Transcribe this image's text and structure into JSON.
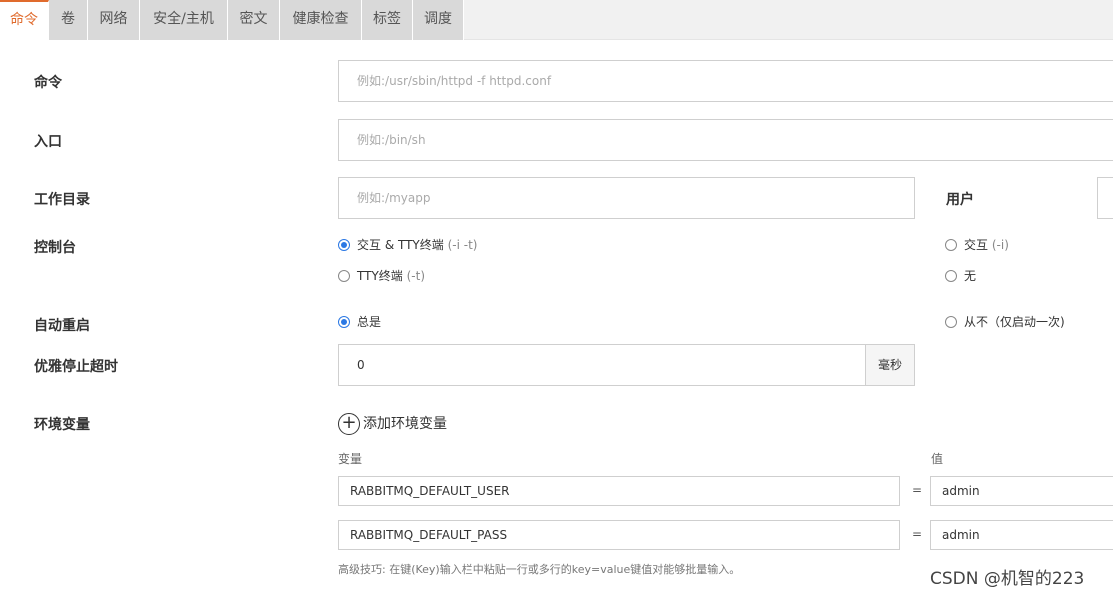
{
  "tabs": [
    {
      "label": "命令",
      "active": true
    },
    {
      "label": "卷"
    },
    {
      "label": "网络"
    },
    {
      "label": "安全/主机"
    },
    {
      "label": "密文"
    },
    {
      "label": "健康检查"
    },
    {
      "label": "标签"
    },
    {
      "label": "调度"
    }
  ],
  "form": {
    "command": {
      "label": "命令",
      "placeholder": "例如:/usr/sbin/httpd -f httpd.conf"
    },
    "entrypoint": {
      "label": "入口",
      "placeholder": "例如:/bin/sh"
    },
    "workdir": {
      "label": "工作目录",
      "placeholder": "例如:/myapp"
    },
    "user": {
      "label": "用户"
    },
    "console": {
      "label": "控制台",
      "options": [
        {
          "text": "交互 & TTY终端",
          "hint": "(-i -t)",
          "selected": true
        },
        {
          "text": "交互",
          "hint": "(-i)",
          "selected": false
        },
        {
          "text": "TTY终端",
          "hint": "(-t)",
          "selected": false
        },
        {
          "text": "无",
          "hint": "",
          "selected": false
        }
      ]
    },
    "restart": {
      "label": "自动重启",
      "options": [
        {
          "text": "总是",
          "selected": true
        },
        {
          "text": "从不（仅启动一次)",
          "selected": false
        }
      ]
    },
    "graceful_stop": {
      "label": "优雅停止超时",
      "value": "0",
      "unit": "毫秒"
    },
    "env": {
      "label": "环境变量",
      "add_label": "添加环境变量",
      "key_header": "变量",
      "value_header": "值",
      "equals": "=",
      "rows": [
        {
          "key": "RABBITMQ_DEFAULT_USER",
          "value": "admin"
        },
        {
          "key": "RABBITMQ_DEFAULT_PASS",
          "value": "admin"
        }
      ],
      "tip": "高级技巧: 在键(Key)输入栏中粘贴一行或多行的key=value键值对能够批量输入。"
    }
  },
  "watermark": "CSDN @机智的223",
  "colors": {
    "accent": "#e06b2d",
    "radio": "#2b78e4"
  }
}
